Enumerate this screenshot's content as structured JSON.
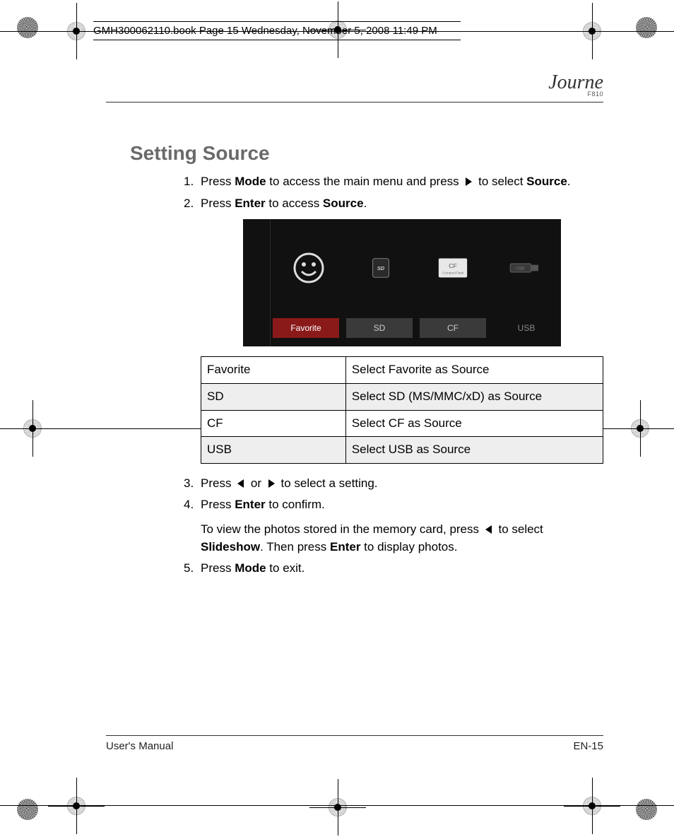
{
  "book_header": "GMH300062110.book  Page 15  Wednesday, November 5, 2008  11:49 PM",
  "brand": {
    "name": "Journe",
    "model": "F810"
  },
  "title": "Setting Source",
  "steps": {
    "s1a": "Press ",
    "s1b": "Mode",
    "s1c": " to access the main menu and press ",
    "s1d": " to select ",
    "s1e": "Source",
    "s1f": ".",
    "s2a": "Press ",
    "s2b": "Enter",
    "s2c": " to access ",
    "s2d": "Source",
    "s2e": ".",
    "s3a": "Press ",
    "s3b": " or ",
    "s3c": " to select a setting.",
    "s4a": "Press ",
    "s4b": "Enter",
    "s4c": " to confirm.",
    "spa": "To view the photos stored in the memory card, press ",
    "spb": " to select ",
    "spc": "Slideshow",
    "spd": ". Then press ",
    "spe": "Enter",
    "spf": " to display photos.",
    "s5a": "Press ",
    "s5b": "Mode",
    "s5c": " to exit."
  },
  "device": {
    "labels": [
      "Favorite",
      "SD",
      "CF",
      "USB"
    ]
  },
  "table": [
    {
      "key": "Favorite",
      "desc": "Select Favorite as Source"
    },
    {
      "key": "SD",
      "desc": "Select SD (MS/MMC/xD) as Source"
    },
    {
      "key": "CF",
      "desc": "Select CF as Source"
    },
    {
      "key": "USB",
      "desc": "Select USB as Source"
    }
  ],
  "footer": {
    "left": "User's Manual",
    "right": "EN-15"
  }
}
